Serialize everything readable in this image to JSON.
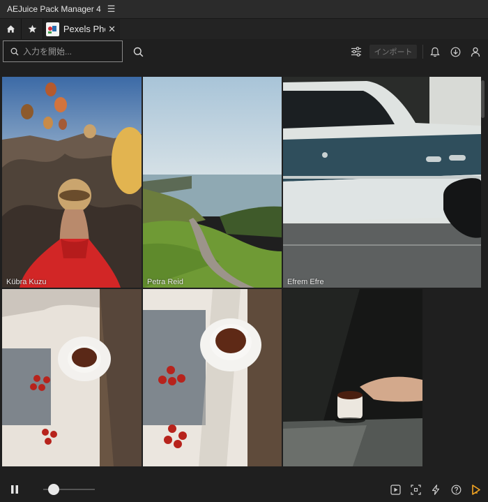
{
  "app": {
    "title": "AEJuice Pack Manager 4"
  },
  "tabs": {
    "active_label": "Pexels Photos"
  },
  "toolbar": {
    "search_placeholder": "入力を開始...",
    "import_label": "インポート"
  },
  "photos": [
    {
      "credit": "Kübra  Kuzu"
    },
    {
      "credit": "Petra Reid"
    },
    {
      "credit": "Efrem  Efre"
    },
    {
      "credit": ""
    },
    {
      "credit": ""
    },
    {
      "credit": ""
    }
  ],
  "player": {
    "zoom_level": 0.2
  },
  "icons": {
    "menu": "hamburger-icon",
    "home": "home-icon",
    "favorites": "star-icon",
    "close": "close-icon",
    "search": "search-icon",
    "filter": "filter-sliders-icon",
    "bell": "bell-icon",
    "download": "download-icon",
    "user": "user-icon",
    "pause": "pause-icon",
    "preview": "play-square-icon",
    "frame": "frame-icon",
    "flash": "lightning-icon",
    "help": "help-icon",
    "brand": "aejuice-logo-icon"
  },
  "colors": {
    "accent": "#f5a623",
    "background": "#1f1f1f"
  }
}
